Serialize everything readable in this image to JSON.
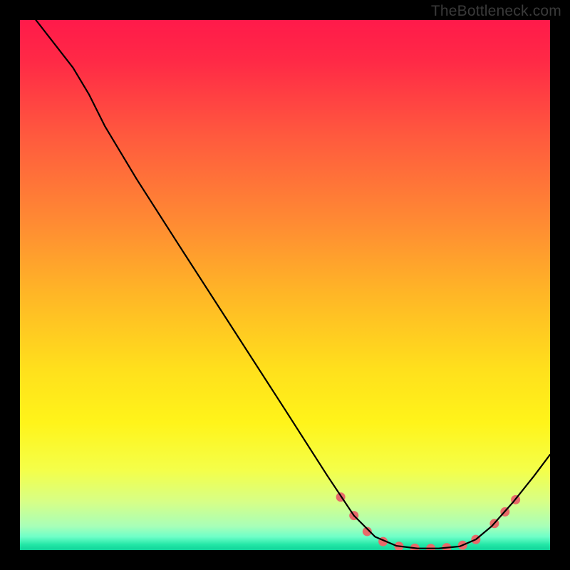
{
  "attribution": "TheBottleneck.com",
  "chart_data": {
    "type": "line",
    "title": "",
    "xlabel": "",
    "ylabel": "",
    "xlim": [
      0,
      100
    ],
    "ylim": [
      0,
      100
    ],
    "background_gradient_stops": [
      {
        "offset": 0,
        "color": "#ff1a4a"
      },
      {
        "offset": 0.08,
        "color": "#ff2a46"
      },
      {
        "offset": 0.22,
        "color": "#ff5a3e"
      },
      {
        "offset": 0.38,
        "color": "#ff8a33"
      },
      {
        "offset": 0.52,
        "color": "#ffb726"
      },
      {
        "offset": 0.66,
        "color": "#ffe01c"
      },
      {
        "offset": 0.76,
        "color": "#fff41a"
      },
      {
        "offset": 0.85,
        "color": "#f4ff4a"
      },
      {
        "offset": 0.91,
        "color": "#d6ff88"
      },
      {
        "offset": 0.955,
        "color": "#a8ffb8"
      },
      {
        "offset": 0.975,
        "color": "#6effc8"
      },
      {
        "offset": 0.99,
        "color": "#22e6a6"
      },
      {
        "offset": 1.0,
        "color": "#11d39a"
      }
    ],
    "series": [
      {
        "name": "curve",
        "color": "#000000",
        "stroke_width": 2.2,
        "points": [
          {
            "x": 3.0,
            "y": 100.0
          },
          {
            "x": 6.5,
            "y": 95.5
          },
          {
            "x": 10.0,
            "y": 91.0
          },
          {
            "x": 13.0,
            "y": 86.0
          },
          {
            "x": 16.0,
            "y": 80.0
          },
          {
            "x": 22.0,
            "y": 70.0
          },
          {
            "x": 30.0,
            "y": 57.5
          },
          {
            "x": 40.0,
            "y": 42.0
          },
          {
            "x": 50.0,
            "y": 26.5
          },
          {
            "x": 58.0,
            "y": 14.0
          },
          {
            "x": 63.0,
            "y": 6.5
          },
          {
            "x": 67.0,
            "y": 2.5
          },
          {
            "x": 71.0,
            "y": 0.8
          },
          {
            "x": 75.0,
            "y": 0.3
          },
          {
            "x": 79.0,
            "y": 0.3
          },
          {
            "x": 83.0,
            "y": 0.7
          },
          {
            "x": 86.0,
            "y": 2.0
          },
          {
            "x": 89.0,
            "y": 4.5
          },
          {
            "x": 93.0,
            "y": 9.0
          },
          {
            "x": 97.0,
            "y": 14.0
          },
          {
            "x": 100.0,
            "y": 18.0
          }
        ]
      }
    ],
    "markers": {
      "color": "#e86a6a",
      "radius": 6.5,
      "points": [
        {
          "x": 60.5,
          "y": 10.0
        },
        {
          "x": 63.0,
          "y": 6.5
        },
        {
          "x": 65.5,
          "y": 3.5
        },
        {
          "x": 68.5,
          "y": 1.6
        },
        {
          "x": 71.5,
          "y": 0.7
        },
        {
          "x": 74.5,
          "y": 0.35
        },
        {
          "x": 77.5,
          "y": 0.3
        },
        {
          "x": 80.5,
          "y": 0.45
        },
        {
          "x": 83.5,
          "y": 0.9
        },
        {
          "x": 86.0,
          "y": 2.0
        },
        {
          "x": 89.5,
          "y": 5.0
        },
        {
          "x": 91.5,
          "y": 7.2
        },
        {
          "x": 93.5,
          "y": 9.5
        }
      ]
    },
    "green_band": {
      "top_pct_from_bottom": 4.5,
      "bottom_pct_from_bottom": 0.0
    }
  }
}
